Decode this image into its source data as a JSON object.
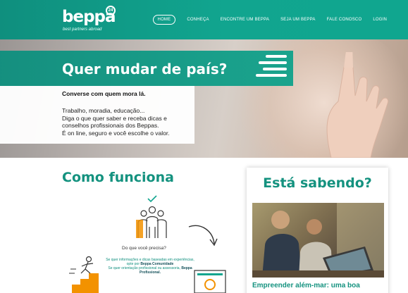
{
  "header": {
    "logo_text": "beppa",
    "logo_badge": "24",
    "tagline": "best partners abroad",
    "nav": [
      {
        "label": "HOME",
        "active": true
      },
      {
        "label": "CONHEÇA",
        "active": false
      },
      {
        "label": "ENCONTRE UM BEPPA",
        "active": false
      },
      {
        "label": "SEJA UM BEPPA",
        "active": false
      },
      {
        "label": "FALE CONOSCO",
        "active": false
      },
      {
        "label": "LOGIN",
        "active": false
      }
    ]
  },
  "hero": {
    "title": "Quer mudar de país?",
    "lead": "Converse com quem mora lá.",
    "lines": [
      "Trabalho, moradia, educação...",
      "Diga o que quer saber e receba dicas e",
      "conselhos profissionais dos Beppas.",
      "É on line, seguro e você escolhe o valor."
    ]
  },
  "how": {
    "title": "Como funciona",
    "question": "Do que você precisa?",
    "note_1": "Se quer informações e dicas baseadas em experiências, opte por",
    "note_1_bold": "Beppa Comunidade",
    "note_2": "Se quer orientação profissional ou assessoria,",
    "note_2_bold": "Beppa Profissional."
  },
  "news": {
    "title": "Está sabendo?",
    "headline": "Empreender além-mar: uma boa"
  },
  "colors": {
    "brand_teal": "#11a58f",
    "brand_dark_teal": "#0f8f7e",
    "accent_orange": "#f39200"
  }
}
